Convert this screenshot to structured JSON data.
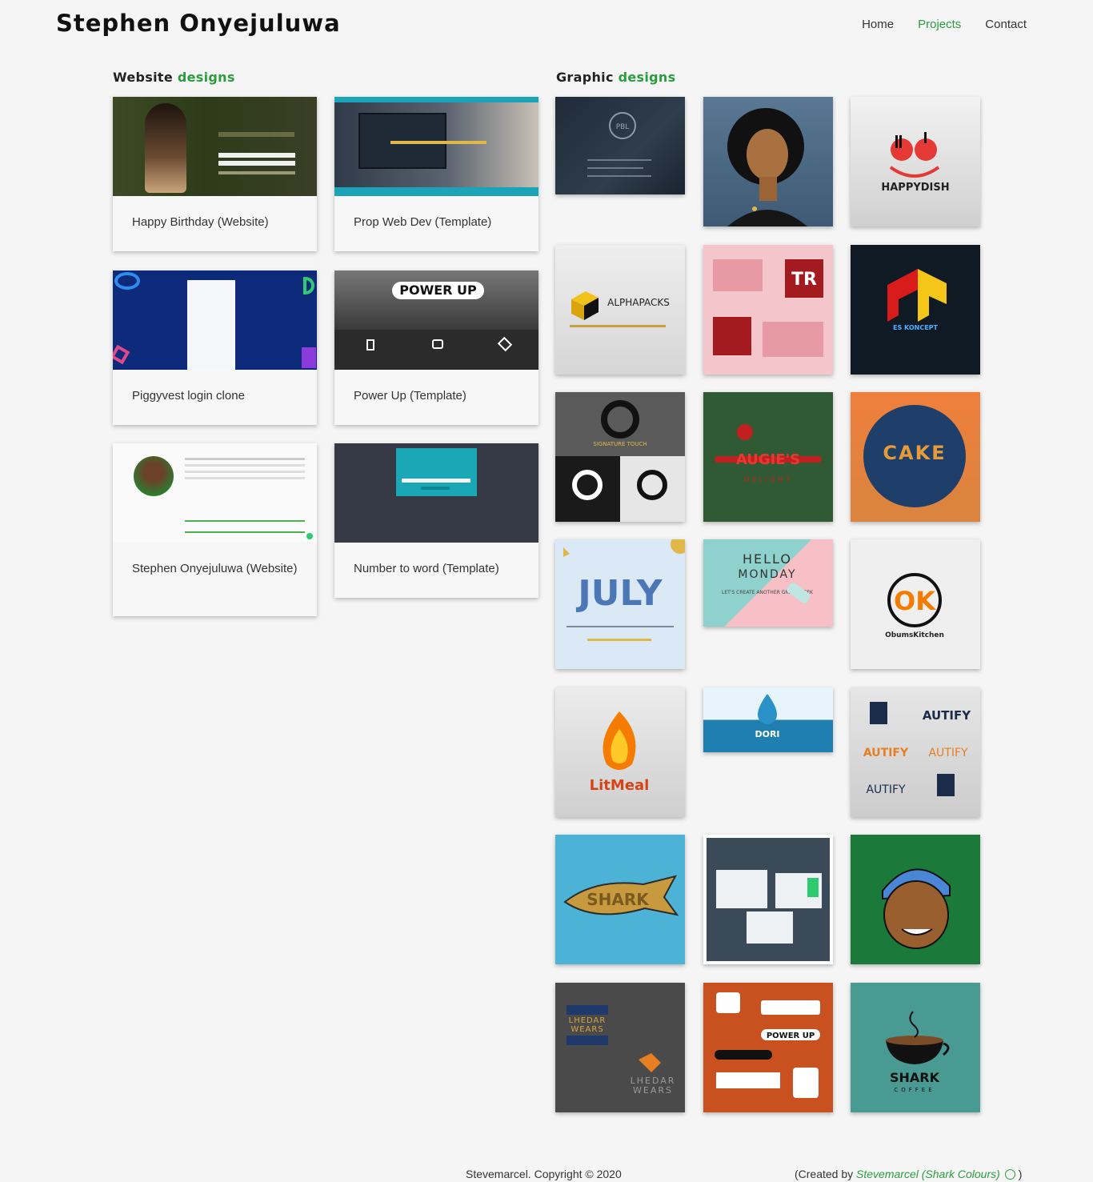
{
  "header": {
    "brand": "Stephen Onyejuluwa",
    "nav": [
      {
        "label": "Home",
        "active": false
      },
      {
        "label": "Projects",
        "active": true
      },
      {
        "label": "Contact",
        "active": false
      }
    ]
  },
  "website_section": {
    "title_plain": "Website",
    "title_accent": "designs",
    "cards": [
      {
        "caption": "Happy Birthday (Website)"
      },
      {
        "caption": "Prop Web Dev (Template)"
      },
      {
        "caption": "Piggyvest login clone"
      },
      {
        "caption": "Power Up (Template)"
      },
      {
        "caption": "Stephen Onyejuluwa (Website)"
      },
      {
        "caption": "Number to word (Template)"
      }
    ]
  },
  "graphic_section": {
    "title_plain": "Graphic",
    "title_accent": "designs",
    "tiles": [
      {
        "icon": "pbl-logo-mockup",
        "text": "PBL"
      },
      {
        "icon": "woman-portrait-illustration",
        "text": ""
      },
      {
        "icon": "happydish-logo",
        "text": "HAPPYDISH"
      },
      {
        "icon": "alphapacks-logo",
        "text": "ALPHAPACKS"
      },
      {
        "icon": "business-card-mockup",
        "text": "TR"
      },
      {
        "icon": "es-koncept-logo",
        "text": "ES KONCEPT"
      },
      {
        "icon": "signature-touch-logo",
        "text": "SIGNATURE TOUCH"
      },
      {
        "icon": "augies-delight-logo",
        "text": "AUGIE'S",
        "subtext": "DELIGHT"
      },
      {
        "icon": "cake-logo",
        "text": "CAKE"
      },
      {
        "icon": "july-poster",
        "text": "JULY"
      },
      {
        "icon": "hello-monday-poster",
        "text": "HELLO",
        "subtext": "MONDAY",
        "extra": "LET'S CREATE ANOTHER GREAT WEEK"
      },
      {
        "icon": "ok-obums-kitchen-logo",
        "text": "OK",
        "subtext": "ObumsKitchen"
      },
      {
        "icon": "litmeal-logo",
        "text": "LitMeal"
      },
      {
        "icon": "dori-logo",
        "text": "DORI"
      },
      {
        "icon": "autify-logo-variants",
        "text": "AUTIFY"
      },
      {
        "icon": "shark-fish-logo",
        "text": "SHARK"
      },
      {
        "icon": "website-mockup-collage",
        "text": ""
      },
      {
        "icon": "man-cap-portrait-illustration",
        "text": ""
      },
      {
        "icon": "lhedar-wears-logo",
        "text": "LHEDAR",
        "subtext": "WEARS"
      },
      {
        "icon": "power-up-logo-variants",
        "text": "POWER UP"
      },
      {
        "icon": "shark-coffee-logo",
        "text": "SHARK",
        "subtext": "COFFEE"
      }
    ]
  },
  "footer": {
    "copyright": "Stevemarcel. Copyright © 2020",
    "created_prefix": "(Created by",
    "created_name": "Stevemarcel (Shark Colours)",
    "created_suffix": ")"
  },
  "colors": {
    "accent": "#2a9d3f",
    "background": "#f5f5f5"
  }
}
